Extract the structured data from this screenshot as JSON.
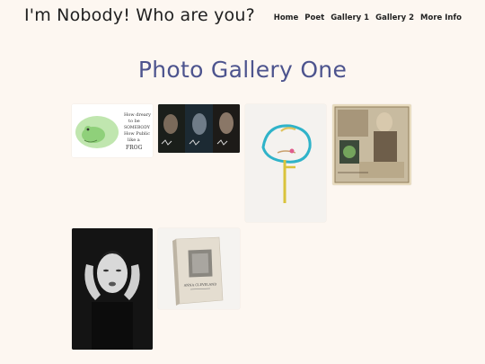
{
  "site": {
    "title": "I'm Nobody! Who are you?"
  },
  "nav": {
    "items": [
      {
        "label": "Home"
      },
      {
        "label": "Poet"
      },
      {
        "label": "Gallery 1"
      },
      {
        "label": "Gallery 2"
      },
      {
        "label": "More Info"
      }
    ]
  },
  "gallery": {
    "heading": "Photo Gallery One",
    "images": [
      {
        "name": "frog-watercolor",
        "caption_lines": [
          "How dreary",
          "to be",
          "SOMEBODY",
          "How Public",
          "like a",
          "FROG"
        ]
      },
      {
        "name": "movie-stills"
      },
      {
        "name": "abstract-painting"
      },
      {
        "name": "collage-portrait"
      },
      {
        "name": "bw-portrait"
      },
      {
        "name": "book-cover",
        "cover_title": "ANNA CLEVELAND"
      }
    ]
  },
  "colors": {
    "background": "#fdf7f1",
    "heading": "#4d548e",
    "text": "#222222"
  }
}
